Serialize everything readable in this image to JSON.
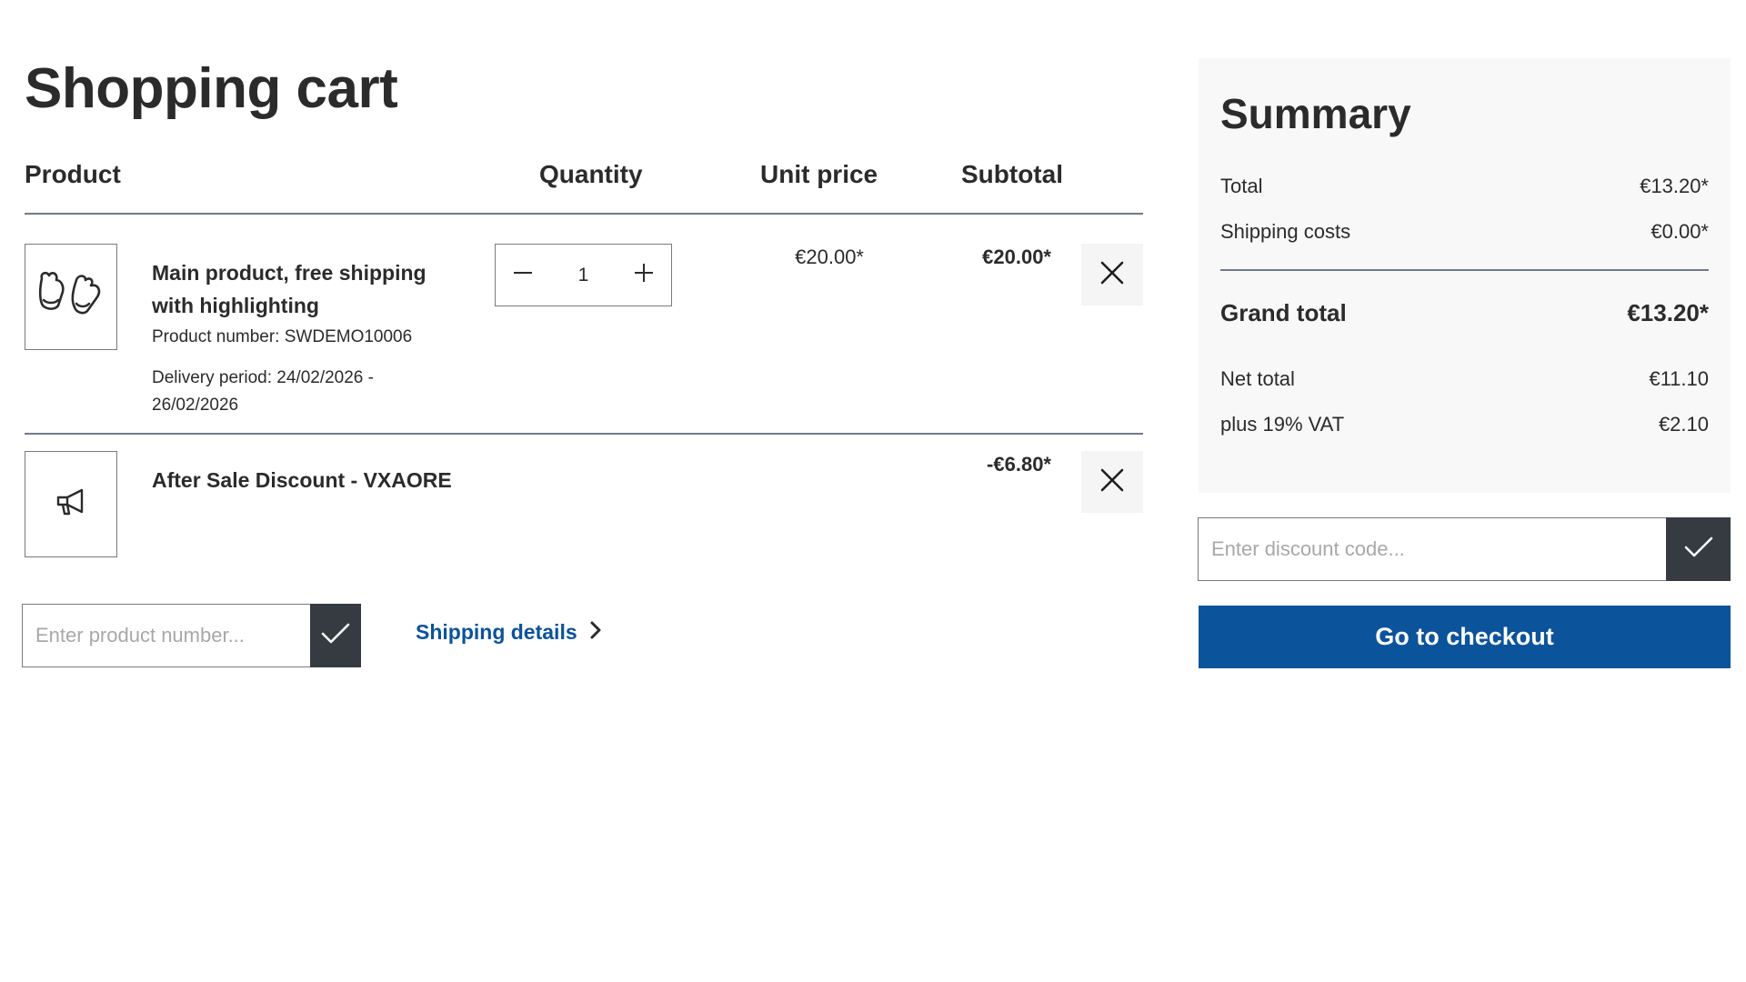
{
  "page": {
    "title": "Shopping cart"
  },
  "cart": {
    "columns": {
      "product": "Product",
      "quantity": "Quantity",
      "unit_price": "Unit price",
      "subtotal": "Subtotal"
    },
    "items": [
      {
        "name": "Main product, free shipping with highlighting",
        "product_number": "Product number: SWDEMO10006",
        "delivery_period": "Delivery period: 24/02/2026 - 26/02/2026",
        "quantity": "1",
        "unit_price": "€20.00*",
        "subtotal": "€20.00*",
        "icon": "mittens-icon"
      },
      {
        "name": "After Sale Discount - VXAORE",
        "subtotal": "-€6.80*",
        "icon": "megaphone-icon"
      }
    ],
    "product_number_input": {
      "placeholder": "Enter product number..."
    },
    "shipping_details_link": "Shipping details"
  },
  "summary": {
    "title": "Summary",
    "rows": {
      "total_label": "Total",
      "total_value": "€13.20*",
      "shipping_label": "Shipping costs",
      "shipping_value": "€0.00*",
      "grand_total_label": "Grand total",
      "grand_total_value": "€13.20*",
      "net_total_label": "Net total",
      "net_total_value": "€11.10",
      "vat_label": "plus 19% VAT",
      "vat_value": "€2.10"
    },
    "discount_input": {
      "placeholder": "Enter discount code..."
    },
    "checkout_label": "Go to checkout"
  },
  "colors": {
    "primary": "#0b539b",
    "dark_button": "#353b41",
    "summary_bg": "#f8f8f8",
    "text": "#2b2b2b"
  }
}
